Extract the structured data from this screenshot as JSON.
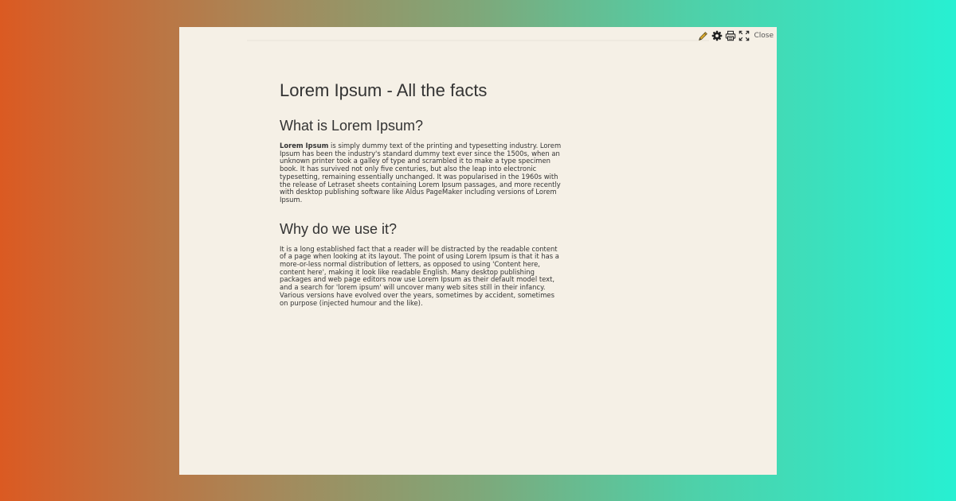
{
  "toolbar": {
    "highlight_icon": "pencil-icon",
    "settings_icon": "gear-icon",
    "print_icon": "printer-icon",
    "fullscreen_icon": "expand-icon",
    "close_label": "Close"
  },
  "article": {
    "title": "Lorem Ipsum - All the facts",
    "sections": [
      {
        "heading": "What is Lorem Ipsum?",
        "lead_bold": "Lorem Ipsum",
        "body": " is simply dummy text of the printing and typesetting industry. Lorem Ipsum has been the industry's standard dummy text ever since the 1500s, when an unknown printer took a galley of type and scrambled it to make a type specimen book. It has survived not only five centuries, but also the leap into electronic typesetting, remaining essentially unchanged. It was popularised in the 1960s with the release of Letraset sheets containing Lorem Ipsum passages, and more recently with desktop publishing software like Aldus PageMaker including versions of Lorem Ipsum."
      },
      {
        "heading": "Why do we use it?",
        "body": "It is a long established fact that a reader will be distracted by the readable content of a page when looking at its layout. The point of using Lorem Ipsum is that it has a more-or-less normal distribution of letters, as opposed to using 'Content here, content here', making it look like readable English. Many desktop publishing packages and web page editors now use Lorem Ipsum as their default model text, and a search for 'lorem ipsum' will uncover many web sites still in their infancy. Various versions have evolved over the years, sometimes by accident, sometimes on purpose (injected humour and the like)."
      }
    ]
  },
  "colors": {
    "page_background": "#f5f0e6",
    "text": "#333333",
    "gradient_left": "#db5a22",
    "gradient_right": "#27f0d2",
    "pencil_accent": "#d9a520"
  }
}
